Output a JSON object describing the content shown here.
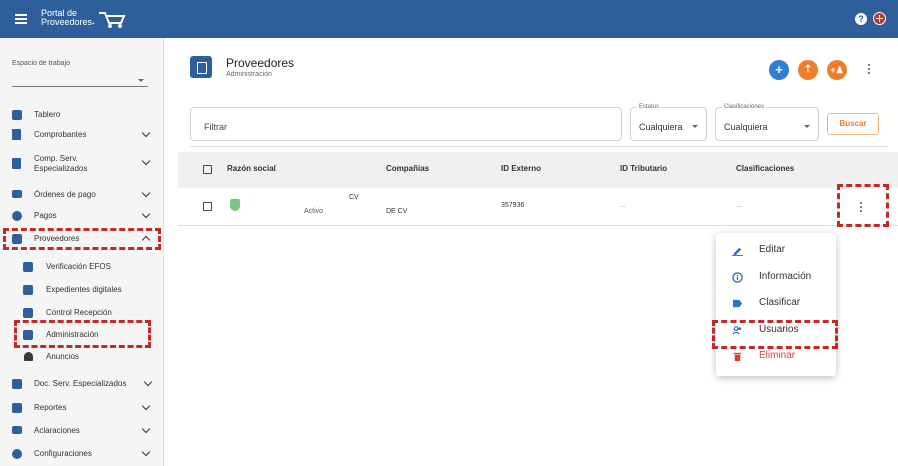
{
  "topbar": {
    "logo_line1": "Portal de",
    "logo_line2": "Proveedores",
    "logo_suffix": "+",
    "brand_color": "#2f5f9a",
    "icons": [
      "menu-icon",
      "help-icon",
      "language-icon"
    ]
  },
  "sidebar": {
    "workspace_label": "Espacio de trabajo",
    "workspace_value": "",
    "items": [
      {
        "label": "Tablero",
        "icon": "dashboard-icon"
      },
      {
        "label": "Comprobantes",
        "icon": "document-icon"
      },
      {
        "label": "Comp. Serv. Especializados",
        "icon": "document-icon"
      },
      {
        "label": "Órdenes de pago",
        "icon": "card-icon"
      },
      {
        "label": "Pagos",
        "icon": "money-icon"
      },
      {
        "label": "Proveedores",
        "icon": "building-icon"
      },
      {
        "label": "Verificación EFOS",
        "icon": "verify-icon"
      },
      {
        "label": "Expedientes digitales",
        "icon": "folder-icon"
      },
      {
        "label": "Control Recepción",
        "icon": "list-icon"
      },
      {
        "label": "Administración",
        "icon": "admin-icon"
      },
      {
        "label": "Anuncios",
        "icon": "bell-icon"
      },
      {
        "label": "Doc. Serv. Especializados",
        "icon": "doc-check-icon"
      },
      {
        "label": "Reportes",
        "icon": "report-icon"
      },
      {
        "label": "Aclaraciones",
        "icon": "mail-icon"
      },
      {
        "label": "Configuraciones",
        "icon": "gear-icon"
      }
    ]
  },
  "main": {
    "title": "Proveedores",
    "subtitle": "Administración",
    "fab_colors": {
      "add": "#2f7fd6",
      "upload": "#f07d2b",
      "users": "#f07d2b"
    },
    "filter_placeholder": "Filtrar",
    "status_label": "Estatus",
    "status_value": "Cualquiera",
    "class_label": "Clasificaciones",
    "class_value": "Cualquiera",
    "search_button": "Buscar",
    "columns": [
      "Razón social",
      "Compañías",
      "ID Externo",
      "ID Tributario",
      "Clasificaciones"
    ],
    "row": {
      "name_suffix": "CV",
      "status": "Activo",
      "company": "DE CV",
      "external_id": "357936",
      "tax_id": "...",
      "classifications": "..."
    }
  },
  "context_menu": {
    "items": [
      {
        "label": "Editar",
        "icon": "edit-icon",
        "color": "#333333"
      },
      {
        "label": "Información",
        "icon": "info-icon",
        "color": "#333333"
      },
      {
        "label": "Clasificar",
        "icon": "label-icon",
        "color": "#333333"
      },
      {
        "label": "Usuarios",
        "icon": "users-icon",
        "color": "#333333"
      },
      {
        "label": "Eliminar",
        "icon": "delete-icon",
        "color": "#e53935"
      }
    ]
  },
  "highlight_color": "#c62828"
}
